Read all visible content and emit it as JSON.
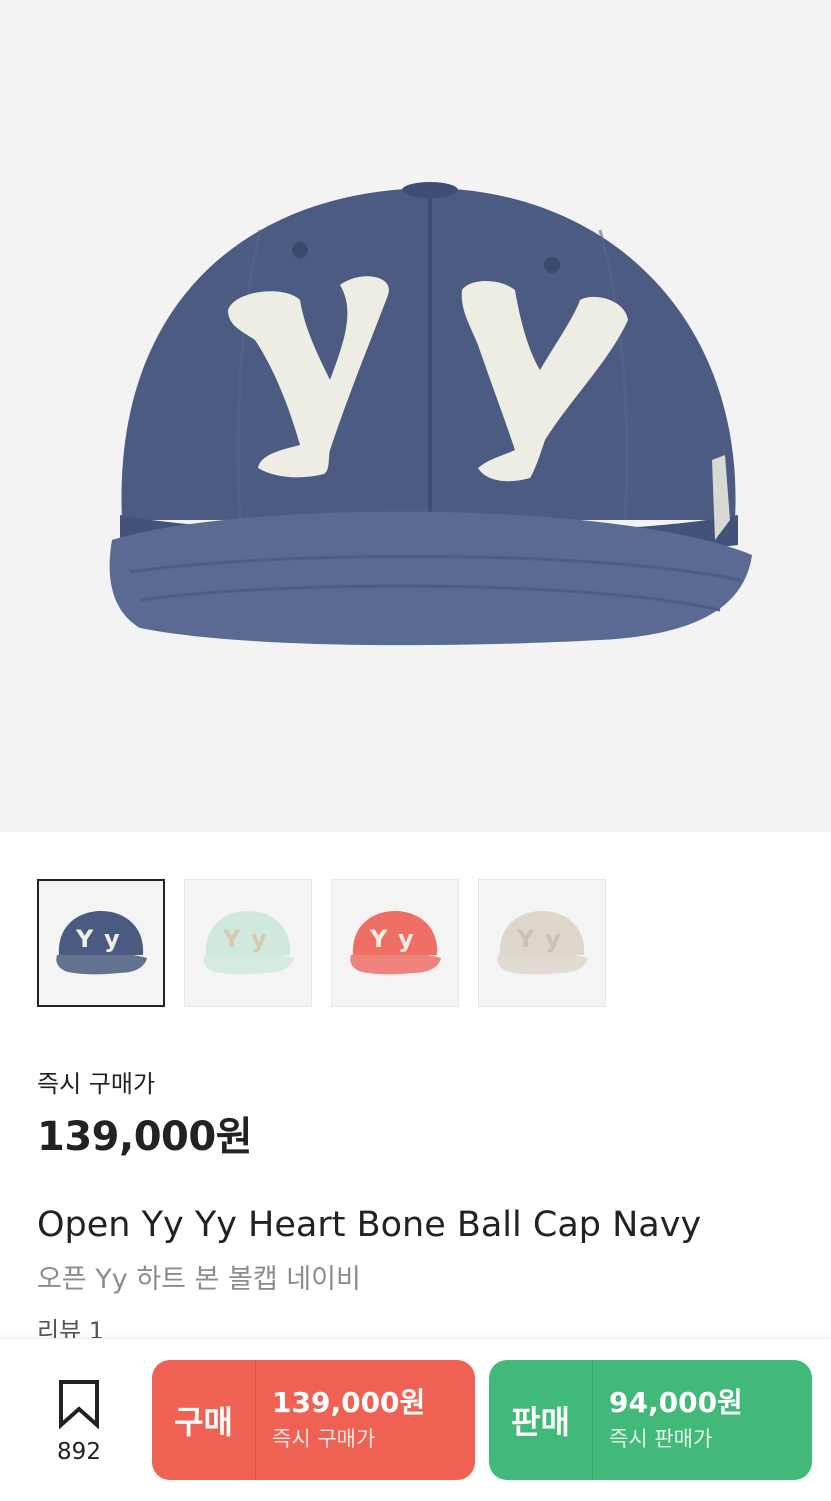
{
  "product": {
    "image_icon": "navy-ball-cap-yy-image",
    "thumbnails": [
      {
        "name": "navy",
        "cap_color": "#4a5a80",
        "logo_color": "#f1efe4",
        "selected": true
      },
      {
        "name": "mint",
        "cap_color": "#cfe9dc",
        "logo_color": "#d9c9b4",
        "selected": false
      },
      {
        "name": "coral",
        "cap_color": "#ef6f66",
        "logo_color": "#f1efe4",
        "selected": false
      },
      {
        "name": "beige",
        "cap_color": "#ddd6ca",
        "logo_color": "#c9c2b3",
        "selected": false
      }
    ],
    "price_label": "즉시 구매가",
    "price": "139,000원",
    "name_en": "Open Yy Yy Heart Bone Ball Cap Navy",
    "name_ko": "오픈 Yy 하트 본 볼캡 네이비",
    "review": "리뷰 1"
  },
  "bottom_bar": {
    "bookmark_icon": "bookmark-icon",
    "bookmark_count": "892",
    "buy": {
      "type": "구매",
      "price": "139,000원",
      "label": "즉시 구매가",
      "color": "#ef6253"
    },
    "sell": {
      "type": "판매",
      "price": "94,000원",
      "label": "즉시 판매가",
      "color": "#41b979"
    }
  }
}
